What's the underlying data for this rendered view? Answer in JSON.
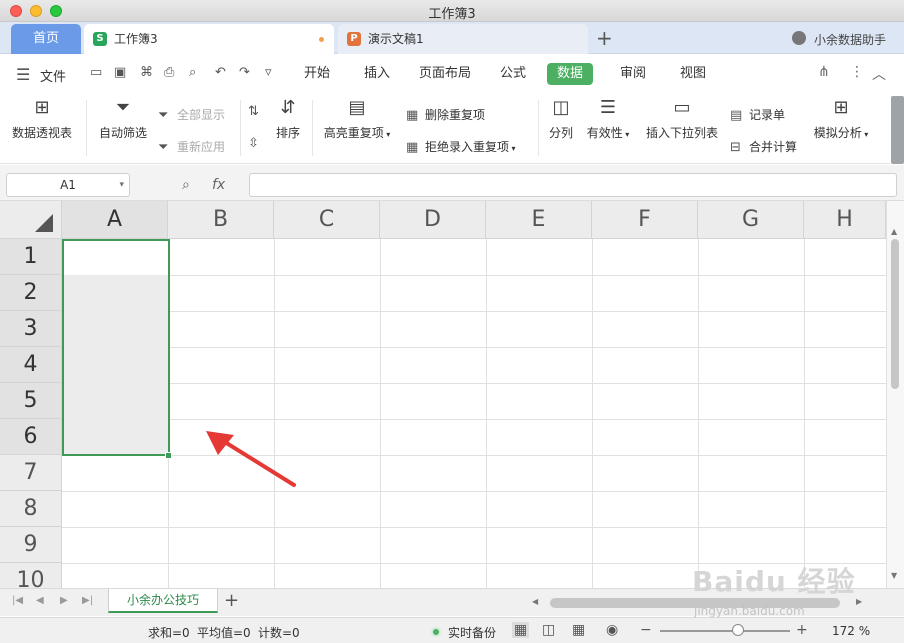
{
  "window": {
    "title": "工作簿3"
  },
  "tabs": {
    "home": "首页",
    "doc_active": "工作簿3",
    "doc_active_icon": "S",
    "doc_inactive": "演示文稿1",
    "doc_inactive_icon": "P",
    "add": "+",
    "user": "小余数据助手"
  },
  "menu": {
    "file": "文件",
    "items": [
      "开始",
      "插入",
      "页面布局",
      "公式",
      "数据",
      "审阅",
      "视图"
    ],
    "active": "数据"
  },
  "ribbon": {
    "pivot": "数据透视表",
    "autofilter": "自动筛选",
    "show_all": "全部显示",
    "reapply": "重新应用",
    "sort": "排序",
    "highlight_dup": "高亮重复项",
    "delete_dup": "删除重复项",
    "reject_dup": "拒绝录入重复项",
    "split": "分列",
    "validity": "有效性",
    "insert_dropdown": "插入下拉列表",
    "record": "记录单",
    "consolidate": "合并计算",
    "what_if": "模拟分析"
  },
  "formula_bar": {
    "name_box": "A1",
    "fx": "fx",
    "value": ""
  },
  "grid": {
    "columns": [
      "A",
      "B",
      "C",
      "D",
      "E",
      "F",
      "G",
      "H"
    ],
    "rows": [
      "1",
      "2",
      "3",
      "4",
      "5",
      "6",
      "7",
      "8",
      "9",
      "10"
    ],
    "selection": "A1:A6"
  },
  "sheets": {
    "active": "小余办公技巧",
    "add": "+"
  },
  "status": {
    "sum": "求和=0",
    "avg": "平均值=0",
    "count": "计数=0",
    "backup": "实时备份",
    "zoom": "172 %",
    "zoom_minus": "−",
    "zoom_plus": "+"
  },
  "watermark": {
    "main": "Baidu 经验",
    "sub": "jingyan.baidu.com"
  },
  "colors": {
    "accent_green": "#4caf62",
    "selection_border": "#3f9a57",
    "home_tab": "#6a9ae8",
    "arrow": "#e53935"
  }
}
